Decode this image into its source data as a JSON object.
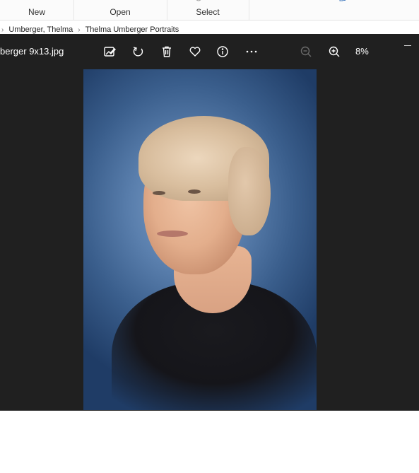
{
  "explorer": {
    "ribbon": {
      "new_label": "New",
      "open_label": "Open",
      "select_label": "Select"
    },
    "breadcrumb": {
      "items": [
        "Umberger, Thelma",
        "Thelma Umberger Portraits"
      ]
    }
  },
  "viewer": {
    "filename": "berger 9x13.jpg",
    "toolbar": {
      "icons": [
        "edit-image-icon",
        "rotate-icon",
        "delete-icon",
        "favorite-icon",
        "info-icon",
        "more-icon",
        "zoom-out-icon",
        "zoom-in-icon"
      ]
    },
    "zoom_level": "8%"
  },
  "colors": {
    "viewer_background": "#202020",
    "ribbon_background": "#fbfbfb",
    "toolbar_icon": "#ffffff",
    "disabled_icon": "#6b6b6b"
  }
}
